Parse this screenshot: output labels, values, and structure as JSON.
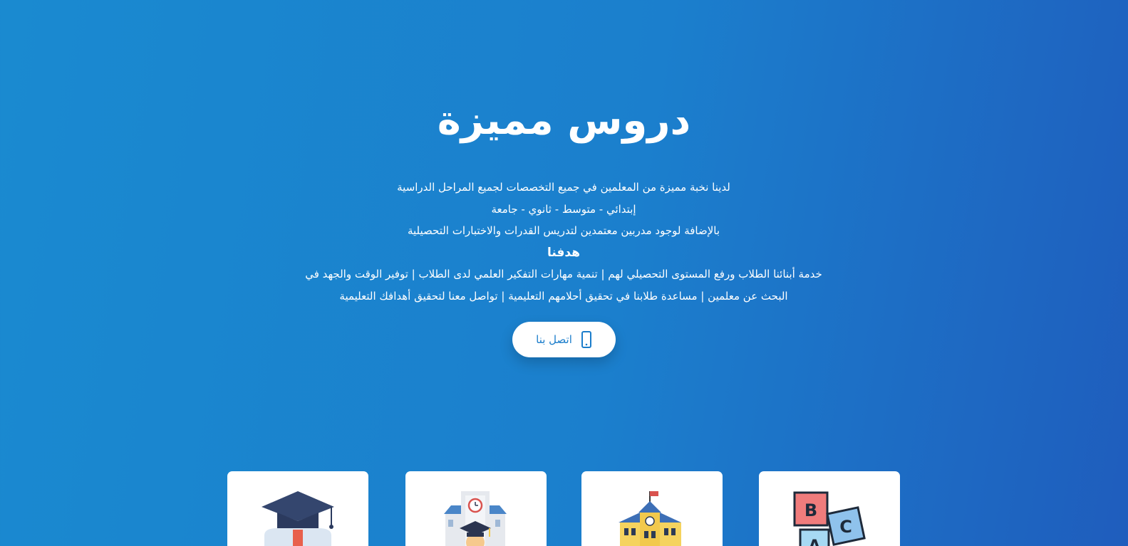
{
  "hero": {
    "title": "دروس مميزة",
    "lines": [
      "لدينا نخبة مميزة من المعلمين في جميع التخصصات لجميع المراحل الدراسية",
      "إبتدائي - متوسط - ثانوي - جامعة",
      "بالإضافة لوجود مدربين معتمدين لتدريس القدرات والاختبارات التحصيلية"
    ],
    "goal_title": "هدفنا",
    "goal_lines": [
      "خدمة أبنائنا الطلاب ورفع المستوى التحصيلي لهم | تنمية مهارات التفكير العلمي لدى الطلاب | توفير الوقت والجهد في",
      "البحث عن معلمين | مساعدة طلابنا في تحقيق أحلامهم التعليمية | تواصل معنا لتحقيق أهدافك التعليمية"
    ],
    "contact_button": {
      "label": "اتصل بنا",
      "icon": "mobile-phone-icon"
    }
  },
  "cards": [
    {
      "icon": "graduation-cap-icon"
    },
    {
      "icon": "graduate-student-building-icon"
    },
    {
      "icon": "school-building-icon"
    },
    {
      "icon": "abc-blocks-icon"
    }
  ],
  "colors": {
    "background_start": "#1a8ad0",
    "background_end": "#1f5dbd",
    "button_text": "#1b7dcb",
    "card_bg": "#ffffff"
  }
}
